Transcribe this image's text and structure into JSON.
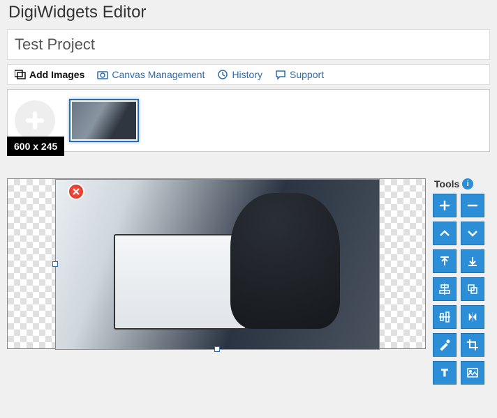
{
  "header": {
    "title": "DigiWidgets Editor"
  },
  "project": {
    "name": "Test Project"
  },
  "toolbar": {
    "add_images": "Add Images",
    "canvas_management": "Canvas Management",
    "history": "History",
    "support": "Support"
  },
  "canvas": {
    "size_label": "600 x 245"
  },
  "tools": {
    "title": "Tools",
    "info": "i",
    "buttons": [
      {
        "name": "zoom-in",
        "glyph": "plus"
      },
      {
        "name": "zoom-out",
        "glyph": "minus"
      },
      {
        "name": "layer-up",
        "glyph": "chevron-up"
      },
      {
        "name": "layer-down",
        "glyph": "chevron-down"
      },
      {
        "name": "bring-front",
        "glyph": "to-top"
      },
      {
        "name": "send-back",
        "glyph": "to-bottom"
      },
      {
        "name": "align-center-h",
        "glyph": "align-center-h"
      },
      {
        "name": "rotate",
        "glyph": "rotate"
      },
      {
        "name": "align-center-v",
        "glyph": "align-center-v"
      },
      {
        "name": "flip-horizontal",
        "glyph": "flip-h"
      },
      {
        "name": "brush",
        "glyph": "brush"
      },
      {
        "name": "crop",
        "glyph": "crop"
      },
      {
        "name": "text",
        "glyph": "text"
      },
      {
        "name": "image",
        "glyph": "image"
      }
    ]
  },
  "colors": {
    "accent": "#2b8ed6",
    "link": "#2b6cb0"
  }
}
